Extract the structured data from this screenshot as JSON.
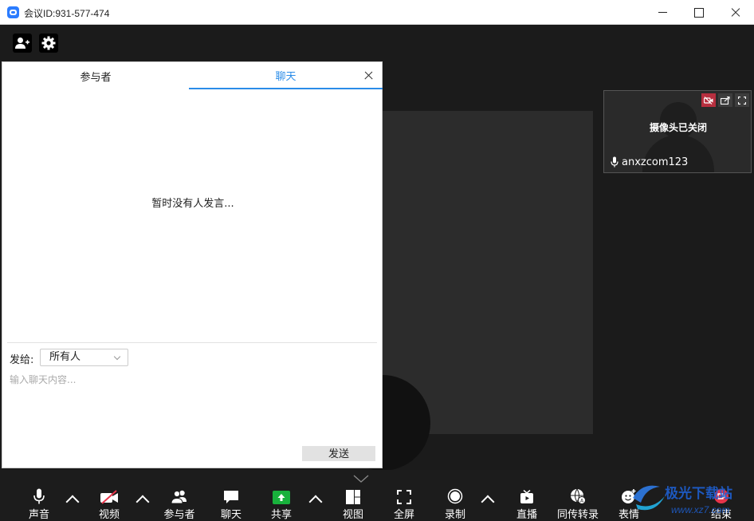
{
  "window": {
    "title": "会议ID:931-577-474"
  },
  "chat_panel": {
    "tabs": [
      {
        "label": "参与者",
        "active": false
      },
      {
        "label": "聊天",
        "active": true
      }
    ],
    "empty_message": "暂时没有人发言...",
    "send_to_label": "发给:",
    "recipient": "所有人",
    "input_placeholder": "输入聊天内容...",
    "send_button": "发送"
  },
  "self_view": {
    "status": "摄像头已关闭",
    "username": "anxzcom123"
  },
  "bottom_bar": {
    "audio": "声音",
    "video": "视频",
    "participants": "参与者",
    "chat": "聊天",
    "share": "共享",
    "view": "视图",
    "fullscreen": "全屏",
    "record": "录制",
    "live": "直播",
    "interpret": "同传转录",
    "reactions": "表情",
    "end": "结束"
  },
  "watermark": {
    "text": "极光下载站",
    "url": "www.xz7.com"
  },
  "colors": {
    "accent_blue": "#2b8ce8",
    "share_green": "#18b13c",
    "end_red": "#e8344a",
    "cam_off_red": "#b72f3f"
  }
}
